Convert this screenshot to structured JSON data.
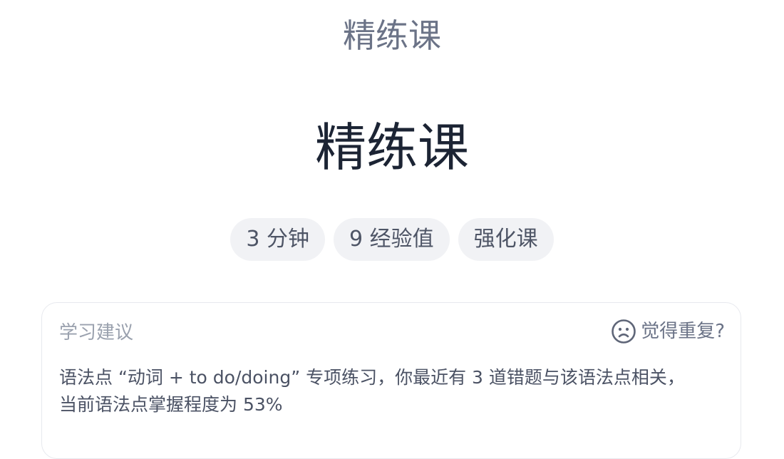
{
  "header": {
    "title": "精练课"
  },
  "hero": {
    "title": "精练课"
  },
  "tags": [
    {
      "label": "3 分钟"
    },
    {
      "label": "9 经验值"
    },
    {
      "label": "强化课"
    }
  ],
  "suggestion": {
    "label": "学习建议",
    "repeat_label": "觉得重复?",
    "repeat_icon": "sad-face-icon",
    "body_line1": "语法点 “动词 + to do/doing” 专项练习，你最近有 3 道错题与该语法点相关，",
    "body_line2": "当前语法点掌握程度为 53%"
  },
  "colors": {
    "header_text": "#6b7387",
    "hero_text": "#1c2434",
    "tag_bg": "#f1f2f5",
    "muted_text": "#9aa1ae",
    "body_text": "#4b5264"
  }
}
